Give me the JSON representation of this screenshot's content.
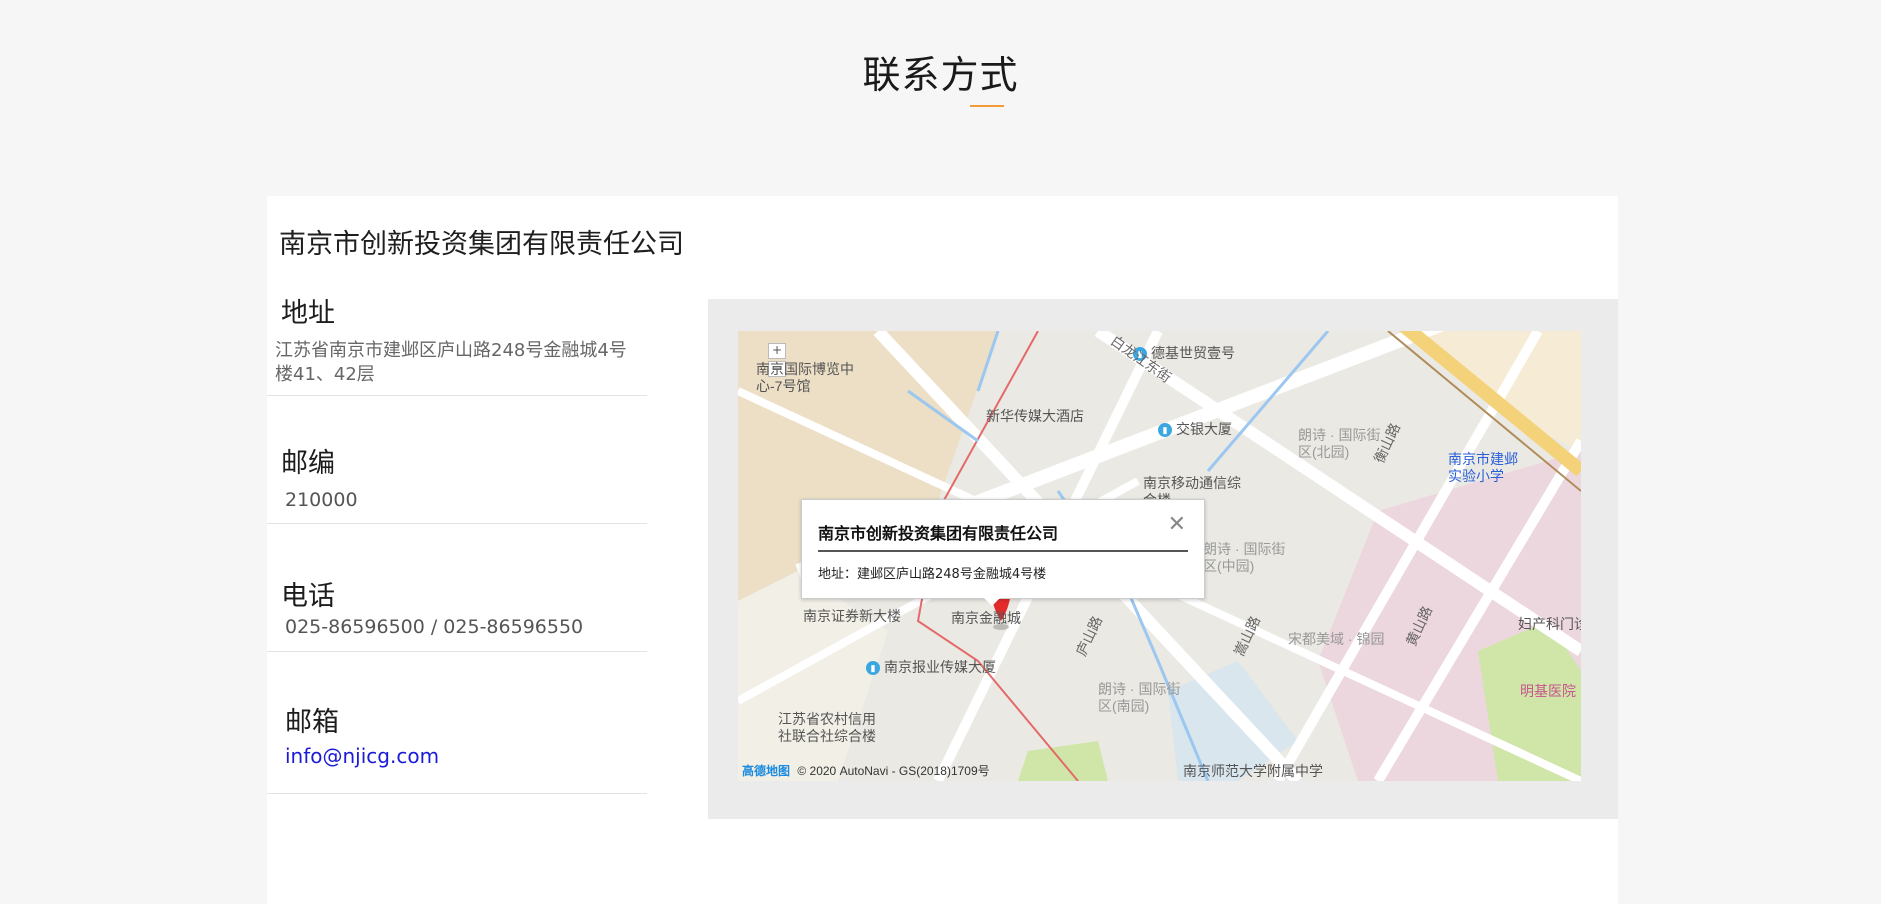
{
  "page": {
    "title": "联系方式",
    "accent": "#f29b38"
  },
  "company": {
    "name": "南京市创新投资集团有限责任公司"
  },
  "contact": {
    "address_label": "地址",
    "address_value": "江苏省南京市建邺区庐山路248号金融城4号楼41、42层",
    "postcode_label": "邮编",
    "postcode_value": "210000",
    "phone_label": "电话",
    "phone_value": "025-86596500 / 025-86596550",
    "email_label": "邮箱",
    "email_value": "info@njicg.com"
  },
  "map": {
    "popup_title": "南京市创新投资集团有限责任公司",
    "popup_address": "地址：建邺区庐山路248号金融城4号楼",
    "popup_close": "✕",
    "zoom_in": "+",
    "zoom_out": "−",
    "footer_logo": "高德地图",
    "footer_copyright": "© 2020 AutoNavi - GS(2018)1709号",
    "pois": {
      "p1": "德基世贸壹号",
      "p2": "南京国际博览中心-7号馆",
      "p3": "新华传媒大酒店",
      "p4": "交银大厦",
      "p5": "朗诗 · 国际街区(北园)",
      "p6": "南京市建邺实验小学",
      "p7": "南京移动通信综合楼",
      "p8": "朗诗 · 国际街区(中园)",
      "p9": "南京证券新大楼",
      "p10": "南京金融城",
      "p11": "宋都美域 · 锦园",
      "p12": "妇产科门诊",
      "p13": "南京报业传媒大厦",
      "p14": "朗诗 · 国际街区(南园)",
      "p15": "明基医院",
      "p16": "江苏省农村信用社联合社综合楼",
      "p17": "南京师范大学附属中学"
    },
    "roads": {
      "r1": "白龙江东街",
      "r2": "庐山路",
      "r3": "黄山路",
      "r4": "嵩山路",
      "r5": "衡山路"
    }
  }
}
